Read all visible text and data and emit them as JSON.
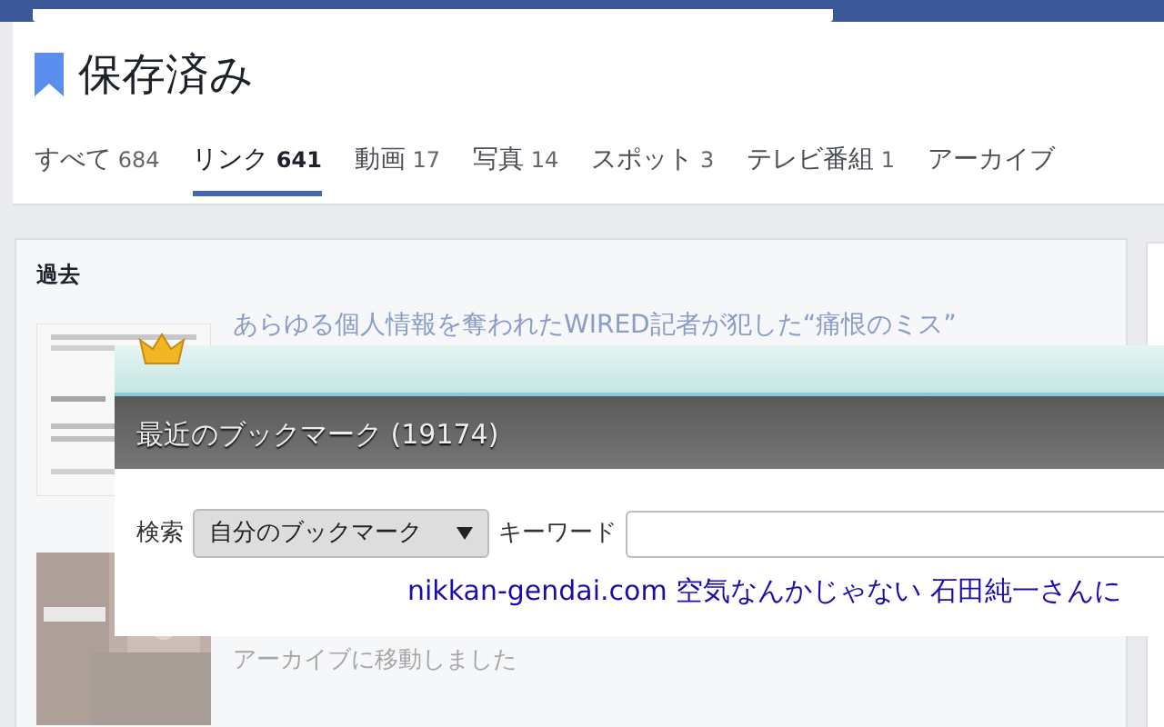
{
  "header": {
    "title": "保存済み"
  },
  "tabs": [
    {
      "label": "すべて",
      "count": "684",
      "selected": false
    },
    {
      "label": "リンク",
      "count": "641",
      "selected": true
    },
    {
      "label": "動画",
      "count": "17",
      "selected": false
    },
    {
      "label": "写真",
      "count": "14",
      "selected": false
    },
    {
      "label": "スポット",
      "count": "3",
      "selected": false
    },
    {
      "label": "テレビ番組",
      "count": "1",
      "selected": false
    },
    {
      "label": "アーカイブ",
      "selected": false
    }
  ],
  "section": {
    "title": "過去",
    "items": [
      {
        "kind": "article",
        "title": "あらゆる個人情報を奪われたWIRED記者が犯した“痛恨のミス”"
      },
      {
        "kind": "archived",
        "note": "アーカイブに移動しました"
      }
    ]
  },
  "popup": {
    "title": "最近のブックマーク (19174)",
    "search_label": "検索",
    "scope": "自分のブックマーク",
    "keyword_label": "キーワード",
    "results": [
      {
        "text": "nikkan-gendai.com 空気なんかじゃない 石田純一さんに"
      }
    ]
  }
}
